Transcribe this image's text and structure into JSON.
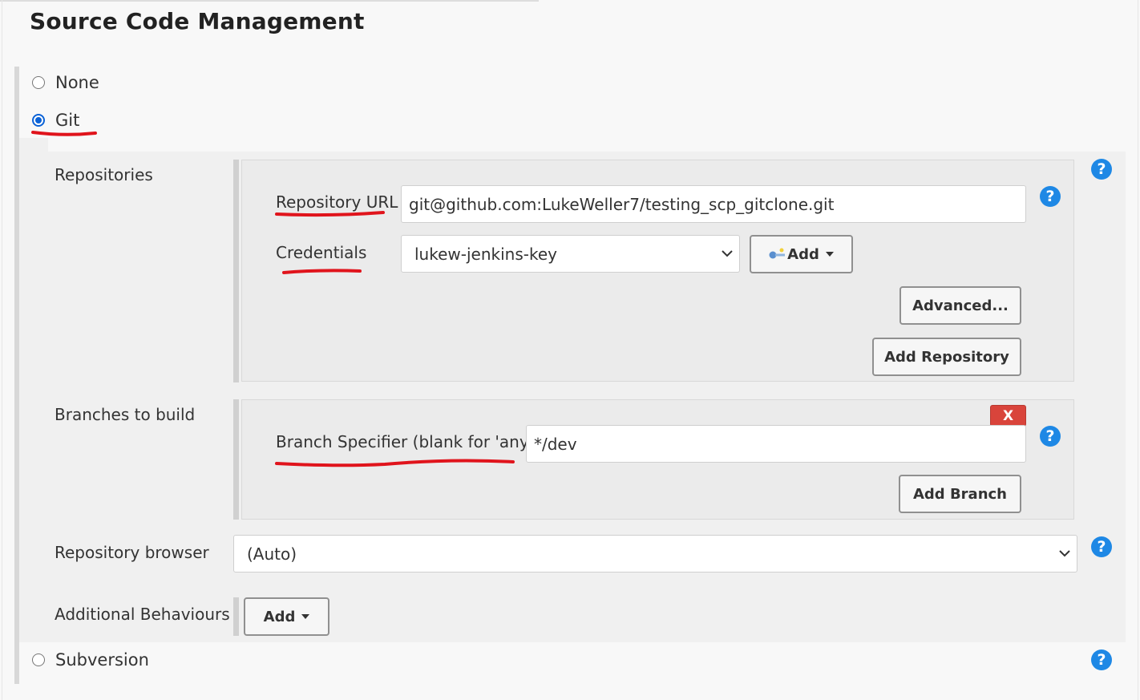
{
  "page": {
    "title": "Source Code Management"
  },
  "scm_options": {
    "none_label": "None",
    "git_label": "Git",
    "subversion_label": "Subversion",
    "selected": "Git"
  },
  "git": {
    "repositories_label": "Repositories",
    "repository_url_label": "Repository URL",
    "repository_url_value": "git@github.com:LukeWeller7/testing_scp_gitclone.git",
    "credentials_label": "Credentials",
    "credentials_value": "lukew-jenkins-key",
    "credentials_add_label": "Add",
    "advanced_label": "Advanced...",
    "add_repository_label": "Add Repository",
    "branches_label": "Branches to build",
    "branch_specifier_label": "Branch Specifier (blank for 'any')",
    "branch_specifier_value": "*/dev",
    "delete_branch_label": "X",
    "add_branch_label": "Add Branch",
    "repo_browser_label": "Repository browser",
    "repo_browser_value": "(Auto)",
    "additional_behaviours_label": "Additional Behaviours",
    "additional_add_label": "Add"
  },
  "help_icon_glyph": "?",
  "colors": {
    "accent": "#0b62d6",
    "help": "#1e88e5",
    "annotation": "#e0141c",
    "delete": "#d9443b"
  },
  "icons": [
    "help-icon",
    "key-icon",
    "chevron-down-icon",
    "caret-down-icon"
  ]
}
